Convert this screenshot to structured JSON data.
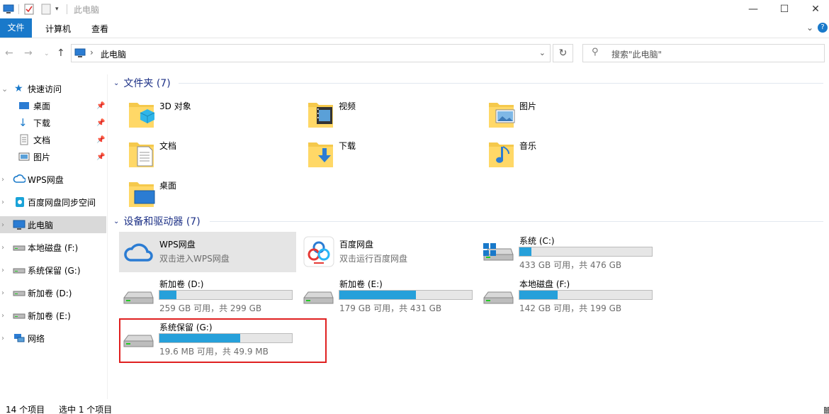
{
  "window": {
    "title": "此电脑",
    "minimize": "—",
    "maximize": "☐",
    "close": "✕"
  },
  "ribbon": {
    "tabs": [
      {
        "label": "文件"
      },
      {
        "label": "计算机"
      },
      {
        "label": "查看"
      }
    ]
  },
  "nav": {
    "address_path": "此电脑",
    "search_placeholder": "搜索\"此电脑\""
  },
  "sidebar": {
    "items": [
      {
        "label": "快速访问"
      },
      {
        "label": "桌面"
      },
      {
        "label": "下载"
      },
      {
        "label": "文档"
      },
      {
        "label": "图片"
      },
      {
        "label": "WPS网盘"
      },
      {
        "label": "百度网盘同步空间"
      },
      {
        "label": "此电脑"
      },
      {
        "label": "本地磁盘 (F:)"
      },
      {
        "label": "系统保留 (G:)"
      },
      {
        "label": "新加卷 (D:)"
      },
      {
        "label": "新加卷 (E:)"
      },
      {
        "label": "网络"
      }
    ]
  },
  "folders_section": {
    "title": "文件夹 (7)",
    "items": [
      {
        "name": "3D 对象"
      },
      {
        "name": "视频"
      },
      {
        "name": "图片"
      },
      {
        "name": "文档"
      },
      {
        "name": "下载"
      },
      {
        "name": "音乐"
      },
      {
        "name": "桌面"
      }
    ]
  },
  "devices_section": {
    "title": "设备和驱动器 (7)",
    "cloud": [
      {
        "name": "WPS网盘",
        "sub": "双击进入WPS网盘"
      },
      {
        "name": "百度网盘",
        "sub": "双击运行百度网盘"
      }
    ],
    "drives": [
      {
        "name": "系统 (C:)",
        "sub": "433 GB 可用，共 476 GB",
        "used": 0.09,
        "color": "#26a0da"
      },
      {
        "name": "新加卷 (D:)",
        "sub": "259 GB 可用，共 299 GB",
        "used": 0.13,
        "color": "#26a0da"
      },
      {
        "name": "新加卷 (E:)",
        "sub": "179 GB 可用，共 431 GB",
        "used": 0.58,
        "color": "#26a0da"
      },
      {
        "name": "本地磁盘 (F:)",
        "sub": "142 GB 可用，共 199 GB",
        "used": 0.29,
        "color": "#26a0da"
      },
      {
        "name": "系统保留 (G:)",
        "sub": "19.6 MB 可用，共 49.9 MB",
        "used": 0.61,
        "color": "#26a0da"
      }
    ]
  },
  "status": {
    "count": "14 个项目",
    "selected": "选中 1 个项目"
  },
  "colors": {
    "accent": "#1979ca",
    "bar_fill": "#26a0da",
    "highlight": "#e02020"
  }
}
